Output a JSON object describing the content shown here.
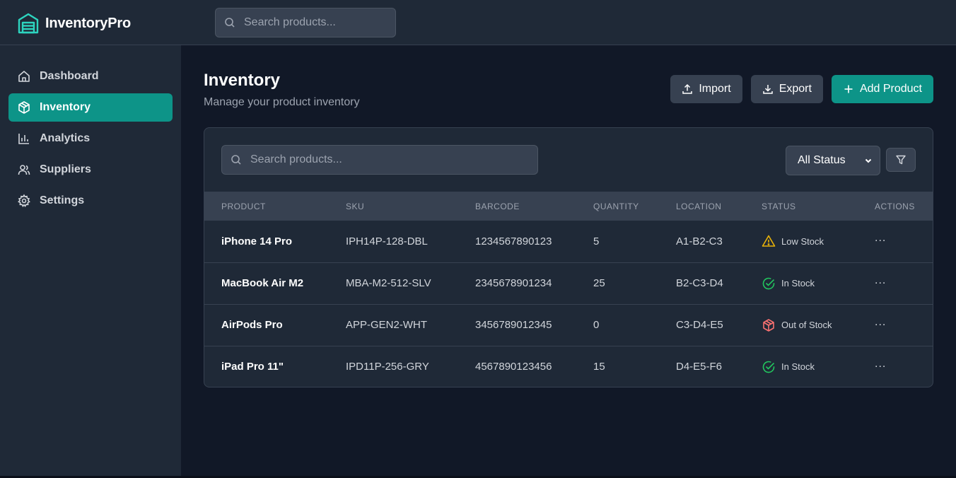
{
  "app": {
    "name": "InventoryPro",
    "search_placeholder": "Search products..."
  },
  "sidebar": {
    "items": [
      {
        "label": "Dashboard",
        "icon": "home-icon",
        "active": false
      },
      {
        "label": "Inventory",
        "icon": "box-icon",
        "active": true
      },
      {
        "label": "Analytics",
        "icon": "bar-chart-icon",
        "active": false
      },
      {
        "label": "Suppliers",
        "icon": "users-icon",
        "active": false
      },
      {
        "label": "Settings",
        "icon": "gear-icon",
        "active": false
      }
    ]
  },
  "page": {
    "title": "Inventory",
    "subtitle": "Manage your product inventory"
  },
  "actions": {
    "import_label": "Import",
    "export_label": "Export",
    "add_label": "Add Product"
  },
  "table": {
    "search_placeholder": "Search products...",
    "status_filter": {
      "selected": "All Status"
    },
    "columns": [
      "PRODUCT",
      "SKU",
      "BARCODE",
      "QUANTITY",
      "LOCATION",
      "STATUS",
      "ACTIONS"
    ],
    "rows": [
      {
        "product": "iPhone 14 Pro",
        "sku": "IPH14P-128-DBL",
        "barcode": "1234567890123",
        "quantity": "5",
        "location": "A1-B2-C3",
        "status": "Low Stock",
        "status_icon": "warning-icon",
        "status_color": "#eab308",
        "actions": "..."
      },
      {
        "product": "MacBook Air M2",
        "sku": "MBA-M2-512-SLV",
        "barcode": "2345678901234",
        "quantity": "25",
        "location": "B2-C3-D4",
        "status": "In Stock",
        "status_icon": "check-circle-icon",
        "status_color": "#22c55e",
        "actions": "..."
      },
      {
        "product": "AirPods Pro",
        "sku": "APP-GEN2-WHT",
        "barcode": "3456789012345",
        "quantity": "0",
        "location": "C3-D4-E5",
        "status": "Out of Stock",
        "status_icon": "package-icon",
        "status_color": "#f87171",
        "actions": "..."
      },
      {
        "product": "iPad Pro 11\"",
        "sku": "IPD11P-256-GRY",
        "barcode": "4567890123456",
        "quantity": "15",
        "location": "D4-E5-F6",
        "status": "In Stock",
        "status_icon": "check-circle-icon",
        "status_color": "#22c55e",
        "actions": "..."
      }
    ]
  },
  "colors": {
    "accent": "#0d9488",
    "background": "#111827",
    "panel": "#1f2937"
  }
}
